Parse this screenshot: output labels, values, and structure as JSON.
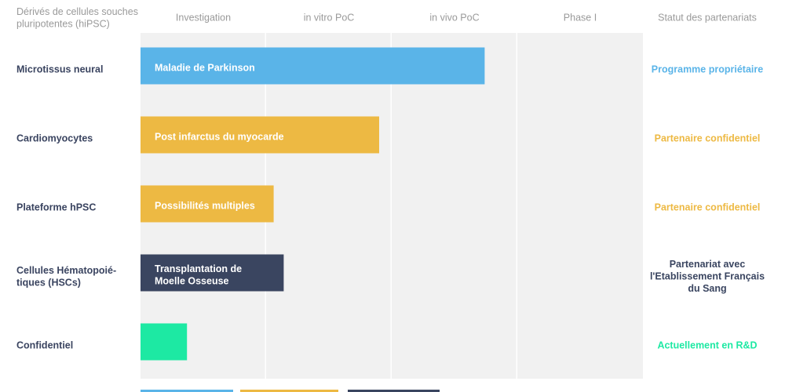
{
  "chart_data": {
    "type": "bar",
    "orientation": "horizontal",
    "row_header": [
      "Dérivés de cellules souches",
      "pluripotentes (hiPSC)"
    ],
    "stages": [
      "Investigation",
      "in vitro PoC",
      "in vivo PoC",
      "Phase I"
    ],
    "status_header": "Statut des partenariats",
    "grid": true,
    "rows": [
      {
        "category": [
          "Microtissus neural"
        ],
        "bar_label": [
          "Maladie de Parkinson"
        ],
        "progress": 2.74,
        "color": "#5ab4e8",
        "status": [
          "Programme propriétaire"
        ],
        "status_color": "#5ab4e8"
      },
      {
        "category": [
          "Cardiomyocytes"
        ],
        "bar_label": [
          "Post infarctus du myocarde"
        ],
        "progress": 1.9,
        "color": "#edb943",
        "status": [
          "Partenaire confidentiel"
        ],
        "status_color": "#edb943"
      },
      {
        "category": [
          "Plateforme hPSC"
        ],
        "bar_label": [
          "Possibilités multiples"
        ],
        "progress": 1.06,
        "color": "#edb943",
        "status": [
          "Partenaire confidentiel"
        ],
        "status_color": "#edb943"
      },
      {
        "category": [
          "Cellules Hématopoié-",
          "tiques (HSCs)"
        ],
        "bar_label": [
          "Transplantation de",
          "Moelle Osseuse"
        ],
        "progress": 1.14,
        "color": "#3a4560",
        "status": [
          "Partenariat avec",
          "l'Etablissement Français",
          "du Sang"
        ],
        "status_color": "#3a4560"
      },
      {
        "category": [
          "Confidentiel"
        ],
        "bar_label": [],
        "progress": 0.37,
        "color": "#1de9a3",
        "status": [
          "Actuellement en R&D"
        ],
        "status_color": "#1de9a3"
      }
    ],
    "legend_colors": [
      "#5ab4e8",
      "#edb943",
      "#3a4560"
    ]
  }
}
